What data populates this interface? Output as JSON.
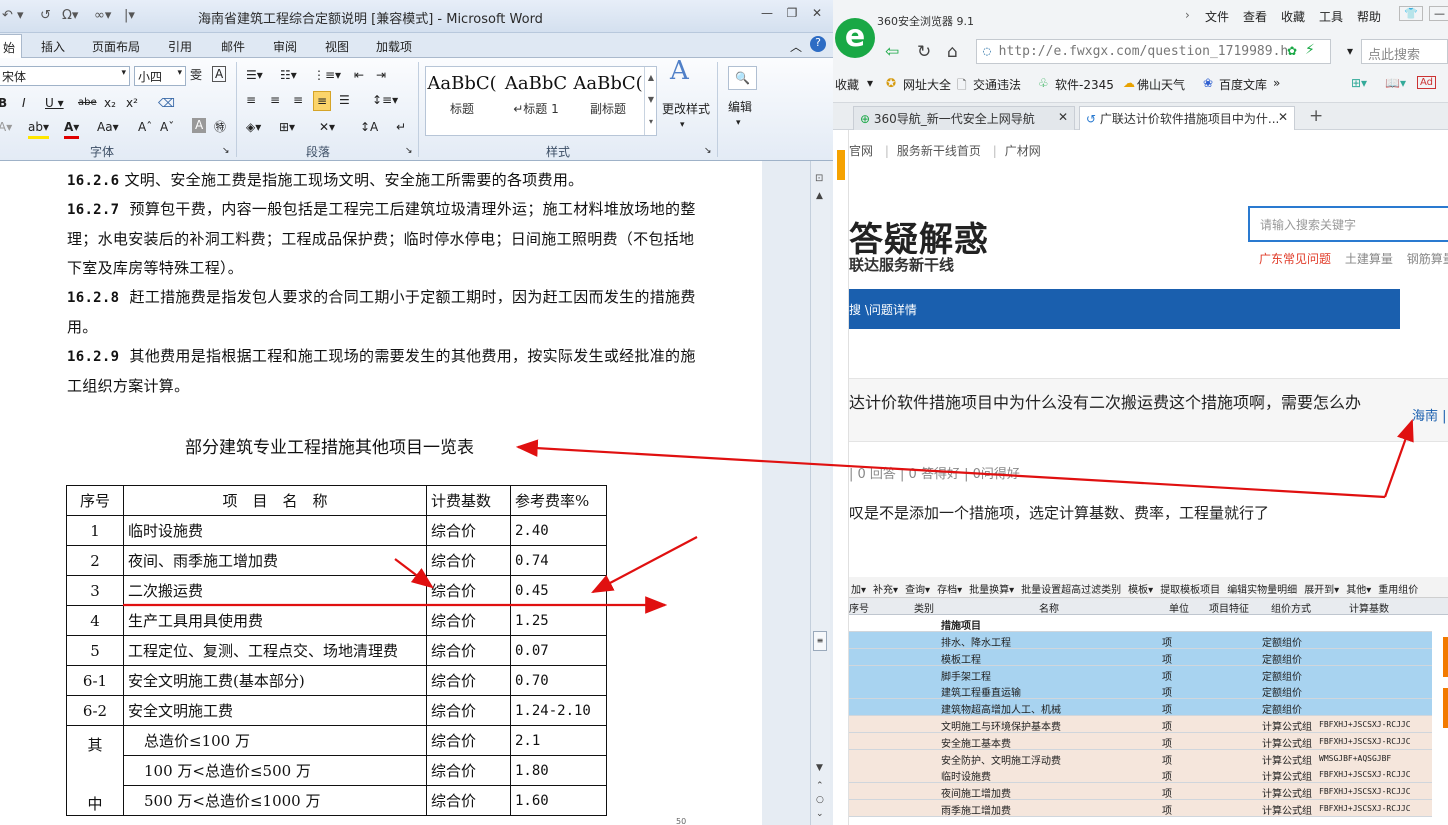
{
  "word": {
    "title": "海南省建筑工程综合定额说明 [兼容模式] - Microsoft Word",
    "tabs": [
      "始",
      "插入",
      "页面布局",
      "引用",
      "邮件",
      "审阅",
      "视图",
      "加载项"
    ],
    "ribbon": {
      "font_name": "宋体",
      "font_size": "小四",
      "group_font": "字体",
      "group_paragraph": "段落",
      "group_styles": "样式",
      "styles": [
        {
          "preview": "AaBbC(",
          "name": "标题"
        },
        {
          "preview": "AaBbC",
          "name": "↵标题 1"
        },
        {
          "preview": "AaBbC(",
          "name": "副标题"
        }
      ],
      "change_styles": "更改样式",
      "edit": "编辑"
    },
    "paragraphs": [
      {
        "num": "16.2.6",
        "text": "文明、安全施工费是指施工现场文明、安全施工所需要的各项费用。"
      },
      {
        "num": "16.2.7",
        "text": "预算包干费，内容一般包括是工程完工后建筑垃圾清理外运；施工材料堆放场地的整理；水电安装后的补洞工料费；工程成品保护费；临时停水停电；日间施工照明费（不包括地下室及库房等特殊工程）。"
      },
      {
        "num": "16.2.8",
        "text": "赶工措施费是指发包人要求的合同工期小于定额工期时，因为赶工因而发生的措施费用。"
      },
      {
        "num": "16.2.9",
        "text": "其他费用是指根据工程和施工现场的需要发生的其他费用，按实际发生或经批准的施工组织方案计算。"
      }
    ],
    "table_title": "部分建筑专业工程措施其他项目一览表",
    "table_headers": [
      "序号",
      "项　目　名　称",
      "计费基数",
      "参考费率%"
    ],
    "table_rows": [
      [
        "1",
        "临时设施费",
        "综合价",
        "2.40"
      ],
      [
        "2",
        "夜间、雨季施工增加费",
        "综合价",
        "0.74"
      ],
      [
        "3",
        "二次搬运费",
        "综合价",
        "0.45"
      ],
      [
        "4",
        "生产工具用具使用费",
        "综合价",
        "1.25"
      ],
      [
        "5",
        "工程定位、复测、工程点交、场地清理费",
        "综合价",
        "0.07"
      ],
      [
        "6-1",
        "安全文明施工费(基本部分)",
        "综合价",
        "0.70"
      ],
      [
        "6-2",
        "安全文明施工费",
        "综合价",
        "1.24-2.10"
      ]
    ],
    "table_other_label_1": "其",
    "table_other_label_2": "中",
    "table_other_rows": [
      [
        "总造价≤100 万",
        "综合价",
        "2.1"
      ],
      [
        "100 万<总造价≤500 万",
        "综合价",
        "1.80"
      ],
      [
        "500 万<总造价≤1000 万",
        "综合价",
        "1.60"
      ]
    ],
    "page_num": "50"
  },
  "browser": {
    "app_name": "360安全浏览器 9.1",
    "menu": [
      "文件",
      "查看",
      "收藏",
      "工具",
      "帮助"
    ],
    "url": "http://e.fwxgx.com/question_1719989.h",
    "search_placeholder": "点此搜索",
    "bookmarks": [
      "收藏",
      "网址大全",
      "交通违法",
      "软件-2345",
      "佛山天气",
      "百度文库"
    ],
    "tabs": [
      "360导航_新一代安全上网导航",
      "广联达计价软件措施项目中为什..."
    ],
    "page": {
      "top_links": [
        "官网",
        "服务新干线首页",
        "广材网"
      ],
      "logo_title": "答疑解惑",
      "logo_sub": "联达服务新干线",
      "search_placeholder": "请输入搜索关键字",
      "hot_links": [
        "广东常见问题",
        "土建算量",
        "钢筋算量"
      ],
      "crumb": "搜 \\问题详情",
      "question": "达计价软件措施项目中为什么没有二次搬运费这个措施项啊，需要怎么办",
      "region": "海南",
      "stats": "| 0 回答 | 0 答得好 | 0问得好",
      "answer": "叹是不是添加一个措施项，选定计算基数、费率，工程量就行了"
    },
    "grid": {
      "toolbar": [
        "加▾",
        "补充▾",
        "查询▾",
        "存档▾",
        "批量换算▾",
        "批量设置超高过滤类别",
        "模板▾",
        "提取模板项目",
        "编辑实物量明细",
        "展开到▾",
        "其他▾",
        "重用组价"
      ],
      "headers": [
        "序号",
        "类别",
        "名称",
        "单位",
        "项目特征",
        "组价方式",
        "计算基数"
      ],
      "section": "措施项目",
      "rows": [
        {
          "name": "排水、降水工程",
          "unit": "项",
          "method": "定额组价",
          "base": "",
          "hl": true
        },
        {
          "name": "模板工程",
          "unit": "项",
          "method": "定额组价",
          "base": "",
          "hl": true
        },
        {
          "name": "脚手架工程",
          "unit": "项",
          "method": "定额组价",
          "base": "",
          "hl": true
        },
        {
          "name": "建筑工程垂直运输",
          "unit": "项",
          "method": "定额组价",
          "base": "",
          "hl": true
        },
        {
          "name": "建筑物超高增加人工、机械",
          "unit": "项",
          "method": "定额组价",
          "base": "",
          "hl": true
        },
        {
          "name": "文明施工与环境保护基本费",
          "unit": "项",
          "method": "计算公式组",
          "base": "FBFXHJ+JSCSXJ-RCJJC",
          "hl": false
        },
        {
          "name": "安全施工基本费",
          "unit": "项",
          "method": "计算公式组",
          "base": "FBFXHJ+JSCSXJ-RCJJC",
          "hl": false
        },
        {
          "name": "安全防护、文明施工浮动费",
          "unit": "项",
          "method": "计算公式组",
          "base": "WMSGJBF+AQSGJBF",
          "hl": false
        },
        {
          "name": "临时设施费",
          "unit": "项",
          "method": "计算公式组",
          "base": "FBFXHJ+JSCSXJ-RCJJC",
          "hl": false
        },
        {
          "name": "夜间施工增加费",
          "unit": "项",
          "method": "计算公式组",
          "base": "FBFXHJ+JSCSXJ-RCJJC",
          "hl": false
        },
        {
          "name": "雨季施工增加费",
          "unit": "项",
          "method": "计算公式组",
          "base": "FBFXHJ+JSCSXJ-RCJJC",
          "hl": false
        }
      ]
    }
  },
  "colors": {
    "arrow": "#e01010",
    "nav_blue": "#1a5fae",
    "logo_green": "#19a845",
    "hl_row": "#a8d3f0",
    "calc_row": "#f5e6dc"
  }
}
